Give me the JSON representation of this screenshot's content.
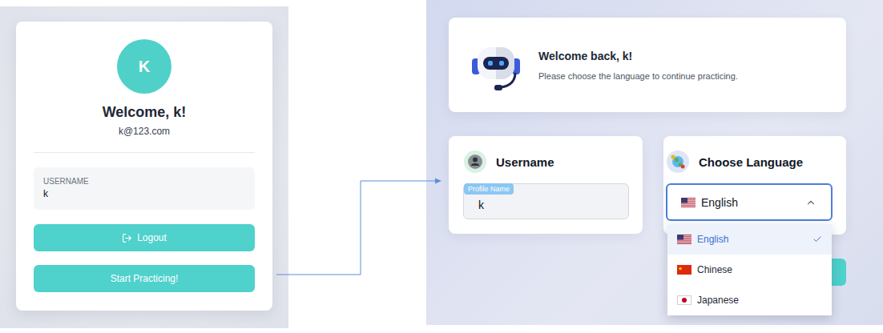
{
  "profile_screen": {
    "avatar": {
      "letter": "K"
    },
    "title": "Welcome, k!",
    "email": "k@123.com",
    "username": {
      "label": "USERNAME",
      "value": "k"
    },
    "buttons": [
      {
        "label": "Logout",
        "kind": "logout"
      },
      {
        "label": "Start Practicing!",
        "kind": "start"
      }
    ]
  },
  "language_screen": {
    "header": {
      "title": "Welcome back, k!",
      "subtitle": "Please choose the language to continue practicing."
    },
    "username_card": {
      "title": "Username",
      "field_label": "Profile Name",
      "value": "k"
    },
    "language_card": {
      "title": "Choose Language",
      "select": {
        "value": "English",
        "expanded": true
      },
      "options": [
        {
          "label": "English",
          "kind": "us",
          "selected": true
        },
        {
          "label": "Chinese",
          "kind": "cn",
          "selected": false
        },
        {
          "label": "Japanese",
          "kind": "jp",
          "selected": false
        }
      ]
    }
  }
}
